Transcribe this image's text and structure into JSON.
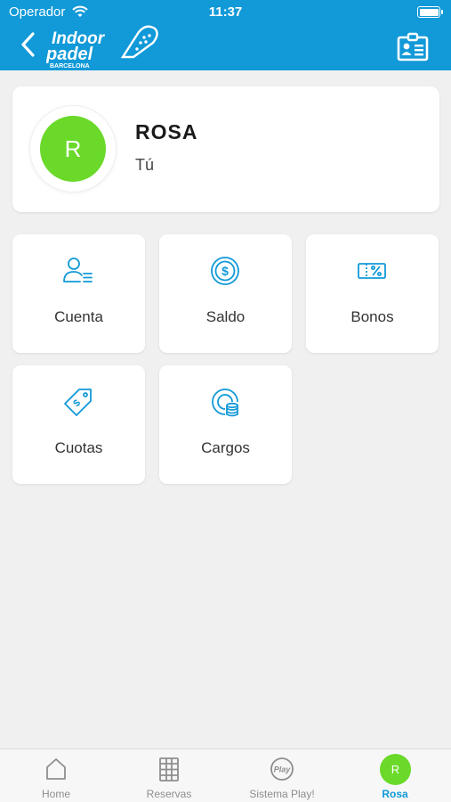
{
  "status_bar": {
    "carrier": "Operador",
    "time": "11:37"
  },
  "header": {
    "logo_line1": "Indoor",
    "logo_line2": "padel",
    "logo_line3": "BARCELONA"
  },
  "profile": {
    "initial": "R",
    "name": "ROSA",
    "subtitle": "Tú"
  },
  "menu": {
    "cuenta": "Cuenta",
    "saldo": "Saldo",
    "bonos": "Bonos",
    "cuotas": "Cuotas",
    "cargos": "Cargos"
  },
  "tabbar": {
    "home": "Home",
    "reservas": "Reservas",
    "play": "Sistema Play!",
    "play_icon_text": "Play",
    "rosa": "Rosa",
    "rosa_initial": "R"
  },
  "colors": {
    "brand_blue": "#1199d8",
    "avatar_green": "#6ad92a",
    "background": "#f0f0f0"
  }
}
